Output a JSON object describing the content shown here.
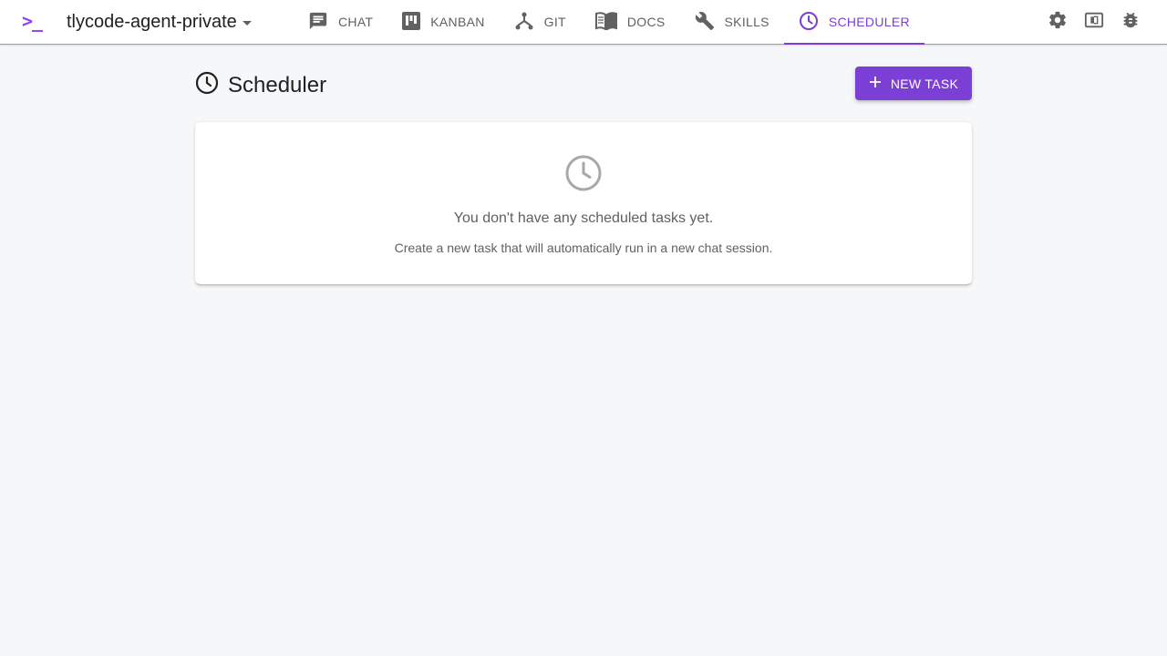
{
  "app": {
    "logo_text": ">_",
    "project_name": "tlycode-agent-private"
  },
  "nav": {
    "tabs": [
      {
        "label": "CHAT",
        "icon": "chat-icon"
      },
      {
        "label": "KANBAN",
        "icon": "kanban-icon"
      },
      {
        "label": "GIT",
        "icon": "git-icon"
      },
      {
        "label": "DOCS",
        "icon": "docs-icon"
      },
      {
        "label": "SKILLS",
        "icon": "wrench-icon"
      },
      {
        "label": "SCHEDULER",
        "icon": "clock-icon",
        "active": true
      }
    ]
  },
  "actions": {
    "icons": [
      "gear-icon",
      "panel-icon",
      "bug-icon"
    ]
  },
  "page": {
    "title": "Scheduler",
    "new_task_label": "NEW TASK"
  },
  "empty_state": {
    "title": "You don't have any scheduled tasks yet.",
    "subtitle": "Create a new task that will automatically run in a new chat session."
  },
  "colors": {
    "accent": "#7b3fd6",
    "logo": "#8e44ec",
    "background": "#f6f7f9",
    "muted_text": "#616161"
  }
}
